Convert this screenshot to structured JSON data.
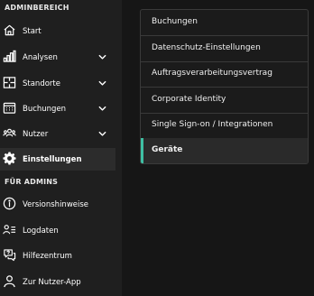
{
  "sidebar": {
    "section_admin": "ADMINBEREICH",
    "section_for_admins": "FÜR ADMINS",
    "items": [
      {
        "label": "Start",
        "icon": "home-icon",
        "has_chevron": false,
        "active": false
      },
      {
        "label": "Analysen",
        "icon": "bar-chart-icon",
        "has_chevron": true,
        "active": false
      },
      {
        "label": "Standorte",
        "icon": "floorplan-icon",
        "has_chevron": true,
        "active": false
      },
      {
        "label": "Buchungen",
        "icon": "calendar-icon",
        "has_chevron": true,
        "active": false
      },
      {
        "label": "Nutzer",
        "icon": "users-icon",
        "has_chevron": true,
        "active": false
      },
      {
        "label": "Einstellungen",
        "icon": "gear-icon",
        "has_chevron": false,
        "active": true
      }
    ],
    "admin_items": [
      {
        "label": "Versionshinweise",
        "icon": "info-icon"
      },
      {
        "label": "Logdaten",
        "icon": "user-list-icon"
      },
      {
        "label": "Hilfezentrum",
        "icon": "help-chat-icon"
      },
      {
        "label": "Zur Nutzer-App",
        "icon": "user-icon"
      }
    ]
  },
  "settings_menu": {
    "items": [
      {
        "label": "Buchungen",
        "active": false
      },
      {
        "label": "Datenschutz-Einstellungen",
        "active": false
      },
      {
        "label": "Auftragsverarbeitungsvertrag",
        "active": false
      },
      {
        "label": "Corporate Identity",
        "active": false
      },
      {
        "label": "Single Sign-on / Integrationen",
        "active": false
      },
      {
        "label": "Geräte",
        "active": true
      }
    ]
  },
  "colors": {
    "accent": "#3fbfa3",
    "sidebar_bg": "#1f1f1f",
    "page_bg": "#161616"
  }
}
